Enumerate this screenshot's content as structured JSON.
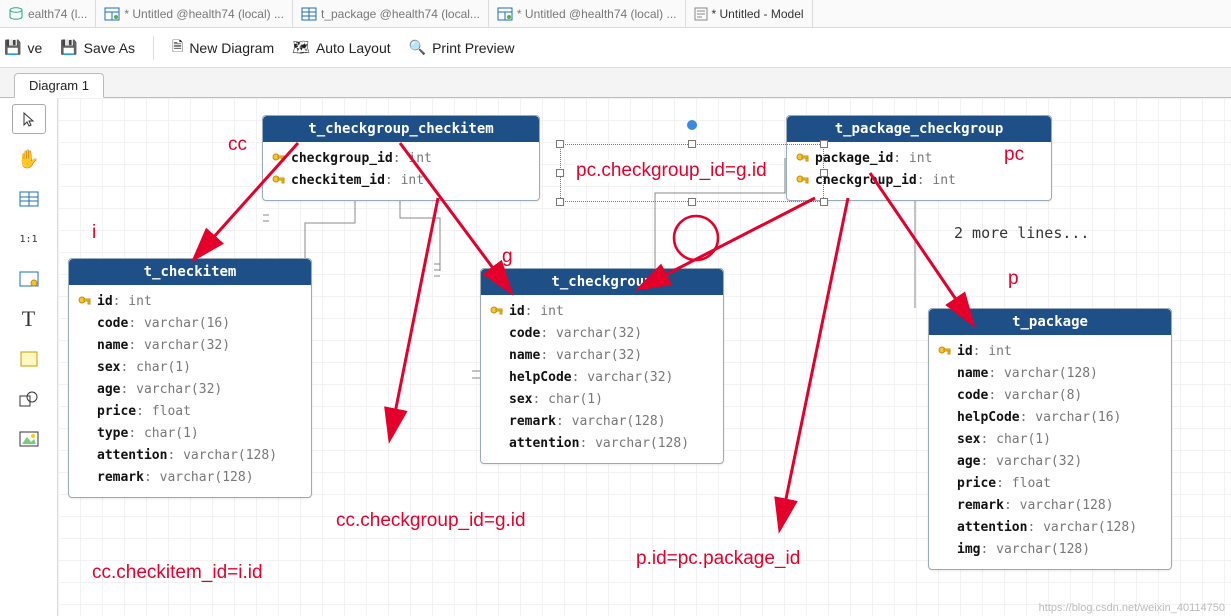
{
  "editorTabs": [
    {
      "label": "ealth74 (l...",
      "kind": "db"
    },
    {
      "label": "* Untitled @health74 (local) ...",
      "kind": "query"
    },
    {
      "label": "t_package @health74 (local...",
      "kind": "table"
    },
    {
      "label": "* Untitled @health74 (local) ...",
      "kind": "query"
    },
    {
      "label": "* Untitled - Model",
      "kind": "model"
    }
  ],
  "toolbar": {
    "save": "ve",
    "saveAs": "Save As",
    "newDiagram": "New Diagram",
    "autoLayout": "Auto Layout",
    "printPreview": "Print Preview"
  },
  "docTab": "Diagram 1",
  "moreLines": "2 more lines...",
  "aliases": {
    "cc": "cc",
    "i": "i",
    "g": "g",
    "pc": "pc",
    "p": "p"
  },
  "joins": {
    "pc_g": "pc.checkgroup_id=g.id",
    "cc_g": "cc.checkgroup_id=g.id",
    "p_pc": "p.id=pc.package_id",
    "cc_i": "cc.checkitem_id=i.id"
  },
  "tables": {
    "cc": {
      "title": "t_checkgroup_checkitem",
      "fields": [
        {
          "name": "checkgroup_id",
          "type": "int",
          "pk": true
        },
        {
          "name": "checkitem_id",
          "type": "int",
          "pk": true
        }
      ]
    },
    "pc": {
      "title": "t_package_checkgroup",
      "fields": [
        {
          "name": "package_id",
          "type": "int",
          "pk": true
        },
        {
          "name": "checkgroup_id",
          "type": "int",
          "pk": true
        }
      ]
    },
    "i": {
      "title": "t_checkitem",
      "fields": [
        {
          "name": "id",
          "type": "int",
          "pk": true
        },
        {
          "name": "code",
          "type": "varchar(16)"
        },
        {
          "name": "name",
          "type": "varchar(32)"
        },
        {
          "name": "sex",
          "type": "char(1)"
        },
        {
          "name": "age",
          "type": "varchar(32)"
        },
        {
          "name": "price",
          "type": "float"
        },
        {
          "name": "type",
          "type": "char(1)"
        },
        {
          "name": "attention",
          "type": "varchar(128)"
        },
        {
          "name": "remark",
          "type": "varchar(128)"
        }
      ]
    },
    "g": {
      "title": "t_checkgroup",
      "fields": [
        {
          "name": "id",
          "type": "int",
          "pk": true
        },
        {
          "name": "code",
          "type": "varchar(32)"
        },
        {
          "name": "name",
          "type": "varchar(32)"
        },
        {
          "name": "helpCode",
          "type": "varchar(32)"
        },
        {
          "name": "sex",
          "type": "char(1)"
        },
        {
          "name": "remark",
          "type": "varchar(128)"
        },
        {
          "name": "attention",
          "type": "varchar(128)"
        }
      ]
    },
    "p": {
      "title": "t_package",
      "fields": [
        {
          "name": "id",
          "type": "int",
          "pk": true
        },
        {
          "name": "name",
          "type": "varchar(128)"
        },
        {
          "name": "code",
          "type": "varchar(8)"
        },
        {
          "name": "helpCode",
          "type": "varchar(16)"
        },
        {
          "name": "sex",
          "type": "char(1)"
        },
        {
          "name": "age",
          "type": "varchar(32)"
        },
        {
          "name": "price",
          "type": "float"
        },
        {
          "name": "remark",
          "type": "varchar(128)"
        },
        {
          "name": "attention",
          "type": "varchar(128)"
        },
        {
          "name": "img",
          "type": "varchar(128)"
        }
      ]
    }
  }
}
